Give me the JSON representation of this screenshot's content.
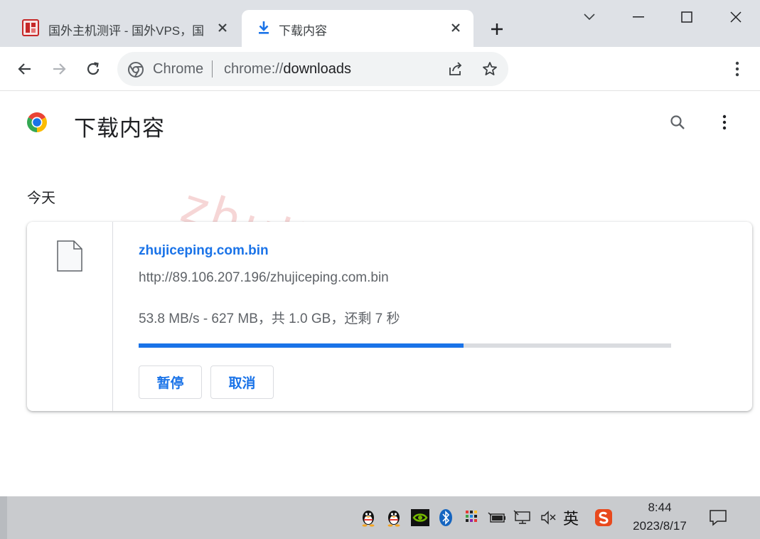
{
  "tabs": [
    {
      "title": "国外主机测评 - 国外VPS，国",
      "active": false,
      "favicon": "seal-favicon"
    },
    {
      "title": "下载内容",
      "active": true,
      "favicon": "download-icon"
    }
  ],
  "window_controls": [
    "chevron-down-icon",
    "minimize-icon",
    "maximize-icon",
    "close-icon"
  ],
  "omnibox": {
    "chip": "Chrome",
    "url_scheme": "chrome://",
    "url_path": "downloads"
  },
  "page": {
    "title": "下载内容",
    "date_heading": "今天",
    "watermark": "zhujiceping.com"
  },
  "download": {
    "file_name": "zhujiceping.com.bin",
    "url": "http://89.106.207.196/zhujiceping.com.bin",
    "status": "53.8 MB/s - 627 MB，共 1.0 GB，还剩 7 秒",
    "progress_fraction": 0.61,
    "pause_label": "暂停",
    "cancel_label": "取消"
  },
  "taskbar": {
    "ime_label": "英",
    "time": "8:44",
    "date": "2023/8/17",
    "tray_icons": [
      "qq-icon",
      "qq-icon-2",
      "nvidia-icon",
      "bluetooth-icon",
      "color-grid-icon",
      "battery-icon",
      "network-icon",
      "volume-muted-icon",
      "sogou-icon",
      "notification-icon"
    ]
  },
  "colors": {
    "accent": "#1a73e8",
    "tabstrip": "#dee1e6",
    "taskbar": "#c9cbce"
  }
}
